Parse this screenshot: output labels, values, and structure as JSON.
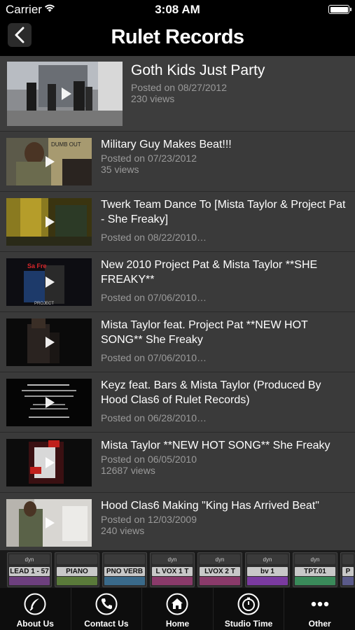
{
  "status": {
    "carrier": "Carrier",
    "time": "3:08 AM"
  },
  "nav": {
    "title": "Rulet Records"
  },
  "featured": {
    "title": "Goth Kids Just Party",
    "posted": "Posted on 08/27/2012",
    "views": "230 views"
  },
  "videos": [
    {
      "title": "Military Guy Makes Beat!!!",
      "posted": "Posted on 07/23/2012",
      "views": "35 views"
    },
    {
      "title": "Twerk Team Dance To [Mista Taylor & Project Pat - She Freaky]",
      "posted": "Posted on 08/22/2010…",
      "views": ""
    },
    {
      "title": "New 2010 Project Pat & Mista Taylor **SHE FREAKY**",
      "posted": "Posted on 07/06/2010…",
      "views": ""
    },
    {
      "title": "Mista Taylor  feat. Project Pat **NEW HOT SONG** She Freaky",
      "posted": "Posted on 07/06/2010…",
      "views": ""
    },
    {
      "title": "Keyz feat. Bars & Mista Taylor (Produced By Hood Clas6 of Rulet Records)",
      "posted": "Posted on 06/28/2010…",
      "views": ""
    },
    {
      "title": "Mista Taylor **NEW HOT SONG**  She Freaky",
      "posted": "Posted on 06/05/2010",
      "views": "12687 views"
    },
    {
      "title": "Hood Clas6 Making \"King Has Arrived Beat\"",
      "posted": "Posted on 12/03/2009",
      "views": "240 views"
    }
  ],
  "mixer": {
    "channels": [
      {
        "dyn": "dyn",
        "label": "LEAD 1 - 57"
      },
      {
        "dyn": "",
        "label": "PIANO"
      },
      {
        "dyn": "",
        "label": "PNO VERB"
      },
      {
        "dyn": "dyn",
        "label": "L VOX 1 T"
      },
      {
        "dyn": "dyn",
        "label": "LVOX 2 T"
      },
      {
        "dyn": "dyn",
        "label": "bv 1"
      },
      {
        "dyn": "dyn",
        "label": "TPT.01"
      },
      {
        "dyn": "",
        "label": "P"
      }
    ]
  },
  "tabs": [
    {
      "label": "About Us",
      "icon": "feather-icon"
    },
    {
      "label": "Contact Us",
      "icon": "phone-icon"
    },
    {
      "label": "Home",
      "icon": "home-icon"
    },
    {
      "label": "Studio Time",
      "icon": "timer-icon"
    },
    {
      "label": "Other",
      "icon": "more-icon"
    }
  ]
}
